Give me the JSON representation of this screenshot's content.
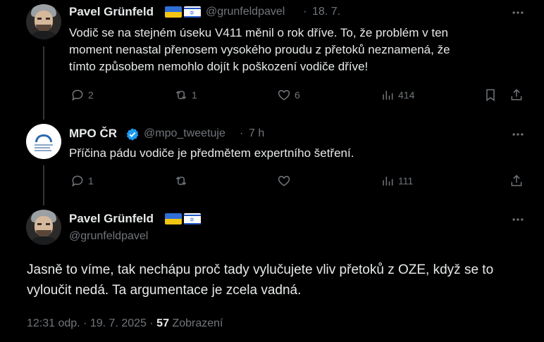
{
  "tweets": [
    {
      "name": "Pavel Grünfeld",
      "handle": "@grunfeldpavel",
      "separator": "·",
      "time": "18. 7.",
      "text": "Vodič se na stejném úseku V411 měnil o rok dříve. To, že problém v ten moment nenastal přenosem vysokého proudu z přetoků neznamená, že tímto způsobem nemohlo dojít k poškození vodiče dříve!",
      "replies": "2",
      "reposts": "1",
      "likes": "6",
      "views": "414"
    },
    {
      "name": "MPO ČR",
      "handle": "@mpo_tweetuje",
      "separator": "·",
      "time": "7 h",
      "text": "Příčina pádu vodiče je předmětem expertního šetření.",
      "replies": "1",
      "reposts": "",
      "likes": "",
      "views": "111"
    }
  ],
  "main_tweet": {
    "name": "Pavel Grünfeld",
    "handle": "@grunfeldpavel",
    "text": "Jasně to víme, tak nechápu proč tady vylučujete vliv přetoků z OZE, když se to vyloučit nedá. Ta argumentace je zcela vadná.",
    "time": "12:31 odp.",
    "date": "19. 7. 2025",
    "views_count": "57",
    "views_label": "Zobrazení",
    "separator": "·"
  },
  "colors": {
    "background": "#000000",
    "text": "#e7e9ea",
    "secondary": "#71767b",
    "verified": "#1d9bf0"
  },
  "icons": {
    "reply": "reply-icon",
    "repost": "repost-icon",
    "like": "heart-icon",
    "views": "analytics-icon",
    "bookmark": "bookmark-icon",
    "share": "share-icon",
    "more": "more-icon",
    "verified": "verified-badge-icon"
  }
}
